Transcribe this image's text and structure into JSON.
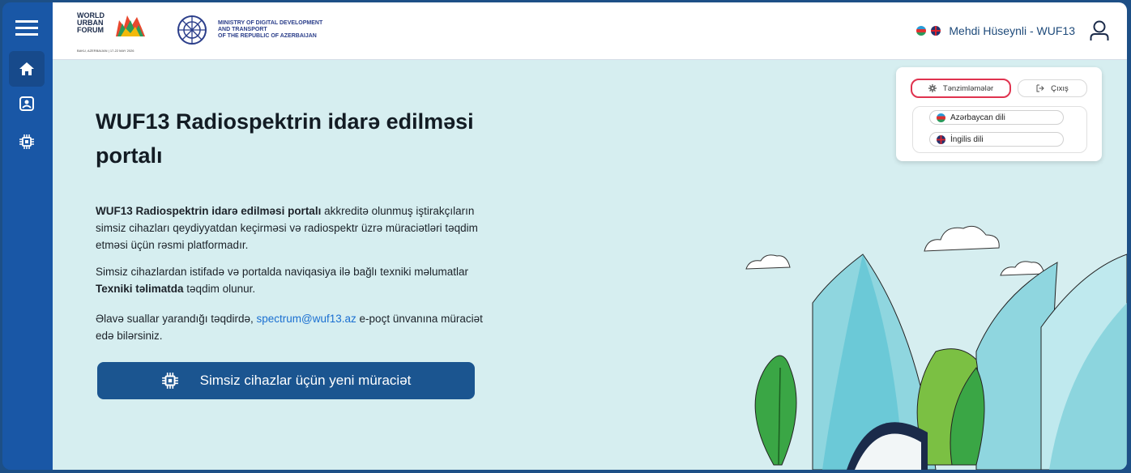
{
  "header": {
    "wuf_logo_lines": [
      "WORLD",
      "URBAN",
      "FORUM"
    ],
    "wuf_logo_sub": "BAKU, AZERBAIJAN | 17-22 MAY 2026",
    "ministry_lines": [
      "MINISTRY OF DIGITAL DEVELOPMENT",
      "AND TRANSPORT",
      "OF THE REPUBLIC OF AZERBAIJAN"
    ],
    "user_name": "Mehdi Hüseynli - WUF13"
  },
  "main": {
    "title": "WUF13 Radiospektrin idarə edilməsi portalı",
    "p1_bold": "WUF13 Radiospektrin idarə edilməsi portalı",
    "p1_rest": " akkreditə olunmuş iştirakçıların simsiz cihazları qeydiyyatdan keçirməsi və radiospektr üzrə müraciətləri təqdim etməsi üçün rəsmi platformadır.",
    "p2_start": "Simsiz cihazlardan istifadə və portalda naviqasiya ilə bağlı texniki məlumatlar ",
    "p2_bold": "Texniki təlimatda",
    "p2_end": " təqdim olunur.",
    "p3_start": "Əlavə suallar yarandığı təqdirdə, ",
    "p3_link": "spectrum@wuf13.az",
    "p3_end": " e-poçt ünvanına müraciət edə bilərsiniz.",
    "cta_label": "Simsiz cihazlar üçün yeni müraciət"
  },
  "menu": {
    "settings_label": "Tənzimləmələr",
    "logout_label": "Çıxış",
    "lang_az": "Azərbaycan dili",
    "lang_en": "İngilis dili"
  },
  "icons": {
    "rail": [
      "hamburger-icon",
      "home-icon",
      "badge-icon",
      "chip-icon"
    ]
  },
  "colors": {
    "rail": "#1957a6",
    "content_bg": "#d6eef0",
    "cta": "#1b5590",
    "settings_highlight": "#e0334f",
    "link": "#1a6fd1"
  }
}
